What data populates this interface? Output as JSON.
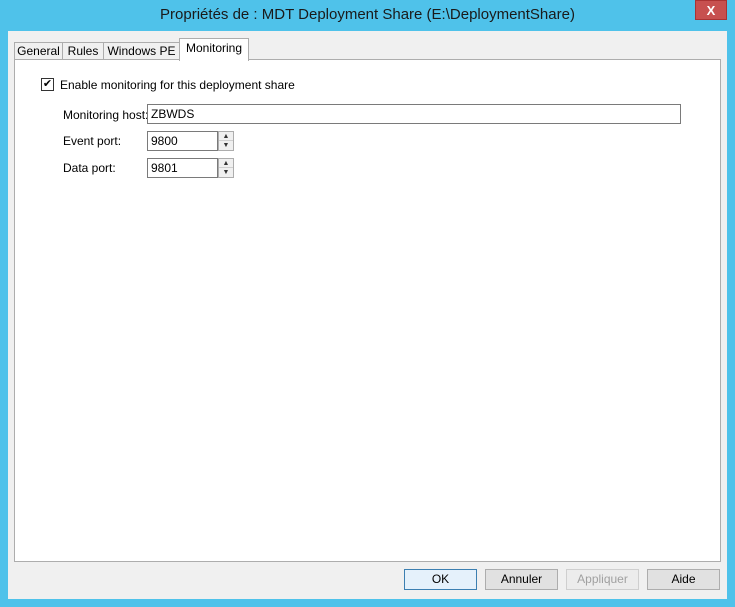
{
  "window": {
    "title": "Propriétés de : MDT Deployment Share (E:\\DeploymentShare)",
    "close_symbol": "X"
  },
  "tabs": [
    {
      "label": "General"
    },
    {
      "label": "Rules"
    },
    {
      "label": "Windows PE"
    },
    {
      "label": "Monitoring",
      "active": true
    }
  ],
  "monitoring": {
    "enable_label": "Enable monitoring for this deployment share",
    "enabled": true,
    "host_label": "Monitoring host:",
    "host_value": "ZBWDS",
    "event_port_label": "Event port:",
    "event_port_value": "9800",
    "data_port_label": "Data port:",
    "data_port_value": "9801"
  },
  "buttons": {
    "ok": "OK",
    "cancel": "Annuler",
    "apply": "Appliquer",
    "help": "Aide"
  },
  "icons": {
    "check": "✔",
    "spin_up": "▲",
    "spin_down": "▼"
  },
  "colors": {
    "frame": "#4fc2ea",
    "close": "#c7504f"
  }
}
